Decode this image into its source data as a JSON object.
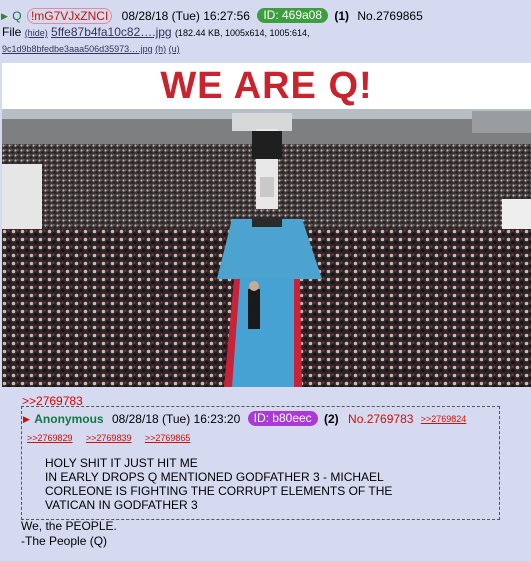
{
  "post": {
    "name": "Q",
    "tripcode_mark": "!",
    "tripcode": "!mG7VJxZNCI",
    "date": "08/28/18 (Tue) 16:27:56",
    "id_label": "ID: 469a08",
    "id_count": "(1)",
    "number": "No.2769865",
    "file": {
      "label": "File",
      "hide": "(hide)",
      "filename": "5ffe87b4fa10c82….jpg",
      "info": "(182.44 KB, 1005x614, 1005:614,",
      "original": "9c1d9b8bfedbe3aaa506d35973….jpg",
      "h": "(h)",
      "u": "(u)"
    },
    "image_title": "WE ARE Q!",
    "reply_ref": ">>2769783",
    "after_lines": [
      "We, the PEOPLE.",
      "-The People (Q)"
    ]
  },
  "quoted": {
    "name": "Anonymous",
    "date": "08/28/18 (Tue) 16:23:20",
    "id_label": "ID: b80eec",
    "id_count": "(2)",
    "number": "No.2769783",
    "backlinks": [
      ">>2769824",
      ">>2769829",
      ">>2769839",
      ">>2769865"
    ],
    "text": [
      "HOLY SHIT IT JUST HIT ME",
      "IN EARLY DROPS Q MENTIONED GODFATHER 3 - MICHAEL",
      "CORLEONE IS FIGHTING THE CORRUPT ELEMENTS OF THE",
      "VATICAN IN GODFATHER 3"
    ]
  },
  "colors": {
    "background": "#d6daf0",
    "name_green": "#117743",
    "link_red": "#cc1105",
    "id_green": "#3c9e3c",
    "id_purple": "#a93ad6",
    "banner_red": "#c8242e"
  }
}
